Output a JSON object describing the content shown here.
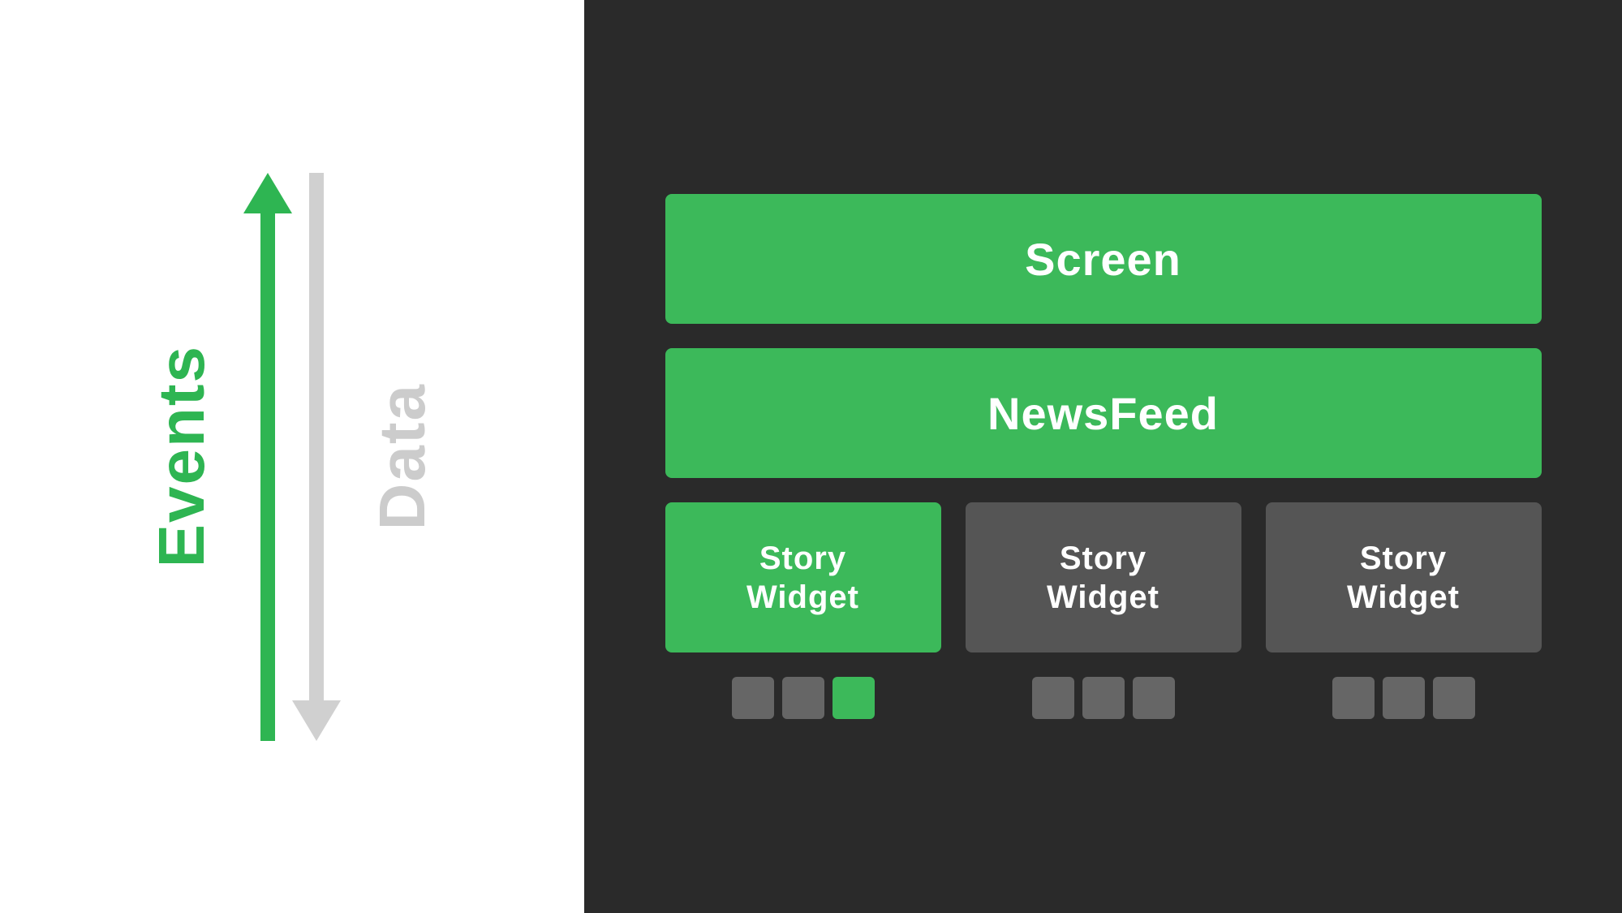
{
  "left_panel": {
    "events_label": "Events",
    "data_label": "Data"
  },
  "right_panel": {
    "screen_label": "Screen",
    "newsfeed_label": "NewsFeed",
    "story_widgets": [
      {
        "label": "Story\nWidget",
        "active": true
      },
      {
        "label": "Story\nWidget",
        "active": false
      },
      {
        "label": "Story\nWidget",
        "active": false
      }
    ],
    "indicator_groups": [
      [
        {
          "active": false
        },
        {
          "active": false
        },
        {
          "active": true
        }
      ],
      [
        {
          "active": false
        },
        {
          "active": false
        },
        {
          "active": false
        }
      ],
      [
        {
          "active": false
        },
        {
          "active": false
        },
        {
          "active": false
        }
      ]
    ]
  },
  "colors": {
    "green": "#3cb95a",
    "dark_bg": "#2a2a2a",
    "white_bg": "#ffffff",
    "gray_arrow": "#d0d0d0",
    "gray_widget": "#555555",
    "gray_dot": "#666666"
  }
}
